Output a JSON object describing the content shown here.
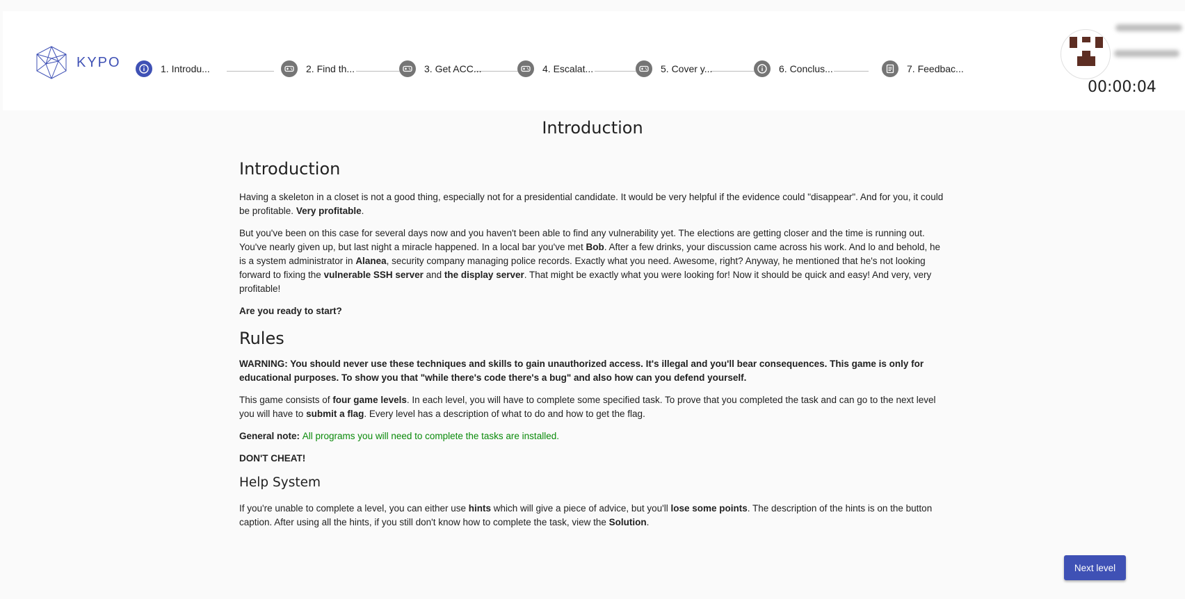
{
  "header": {
    "logo_text": "KYPO",
    "timer": "00:00:04",
    "steps": [
      {
        "label": "1. Introdu...",
        "icon": "info-icon",
        "active": true
      },
      {
        "label": "2. Find th...",
        "icon": "gamepad-icon",
        "active": false
      },
      {
        "label": "3. Get ACC...",
        "icon": "gamepad-icon",
        "active": false
      },
      {
        "label": "4. Escalat...",
        "icon": "gamepad-icon",
        "active": false
      },
      {
        "label": "5. Cover y...",
        "icon": "gamepad-icon",
        "active": false
      },
      {
        "label": "6. Conclus...",
        "icon": "info-icon",
        "active": false
      },
      {
        "label": "7. Feedbac...",
        "icon": "assessment-icon",
        "active": false
      }
    ]
  },
  "page_title": "Introduction",
  "content": {
    "intro_heading": "Introduction",
    "p1_a": "Having a skeleton in a closet is not a good thing, especially not for a presidential candidate. It would be very helpful if the evidence could \"disappear\". And for you, it could be profitable. ",
    "p1_b": "Very profitable",
    "p1_c": ".",
    "p2_a": "But you've been on this case for several days now and you haven't been able to find any vulnerability yet. The elections are getting closer and the time is running out. You've nearly given up, but last night a miracle happened. In a local bar you've met ",
    "p2_bob": "Bob",
    "p2_b": ". After a few drinks, your discussion came across his work. And lo and behold, he is a system administrator in ",
    "p2_alanea": "Alanea",
    "p2_c": ", security company managing police records. Exactly what you need. Awesome, right? Anyway, he mentioned that he's not looking forward to fixing the ",
    "p2_ssh": "vulnerable SSH server",
    "p2_d": " and ",
    "p2_display": "the display server",
    "p2_e": ". That might be exactly what you were looking for! Now it should be quick and easy! And very, very profitable!",
    "ready": "Are you ready to start?",
    "rules_heading": "Rules",
    "warning": "WARNING: You should never use these techniques and skills to gain unauthorized access. It's illegal and you'll bear consequences. This game is only for educational purposes. To show you that \"while there's code there's a bug\" and also how can you defend yourself.",
    "p3_a": "This game consists of ",
    "p3_levels": "four game levels",
    "p3_b": ". In each level, you will have to complete some specified task. To prove that you completed the task and can go to the next level you will have to ",
    "p3_flag": "submit a flag",
    "p3_c": ". Every level has a description of what to do and how to get the flag.",
    "note_label": "General note: ",
    "note_text": "All programs you will need to complete the tasks are installed.",
    "dont_cheat": "DON'T CHEAT!",
    "help_heading": "Help System",
    "p4_a": "If you're unable to complete a level, you can either use ",
    "p4_hints": "hints",
    "p4_b": " which will give a piece of advice, but you'll ",
    "p4_lose": "lose some points",
    "p4_c": ". The description of the hints is on the button caption. After using all the hints, if you still don't know how to complete the task, view the ",
    "p4_solution": "Solution",
    "p4_d": "."
  },
  "next_button": "Next level",
  "colors": {
    "accent": "#3f51b5",
    "inactive_step": "#757575",
    "note_green": "#0a8a0a"
  }
}
